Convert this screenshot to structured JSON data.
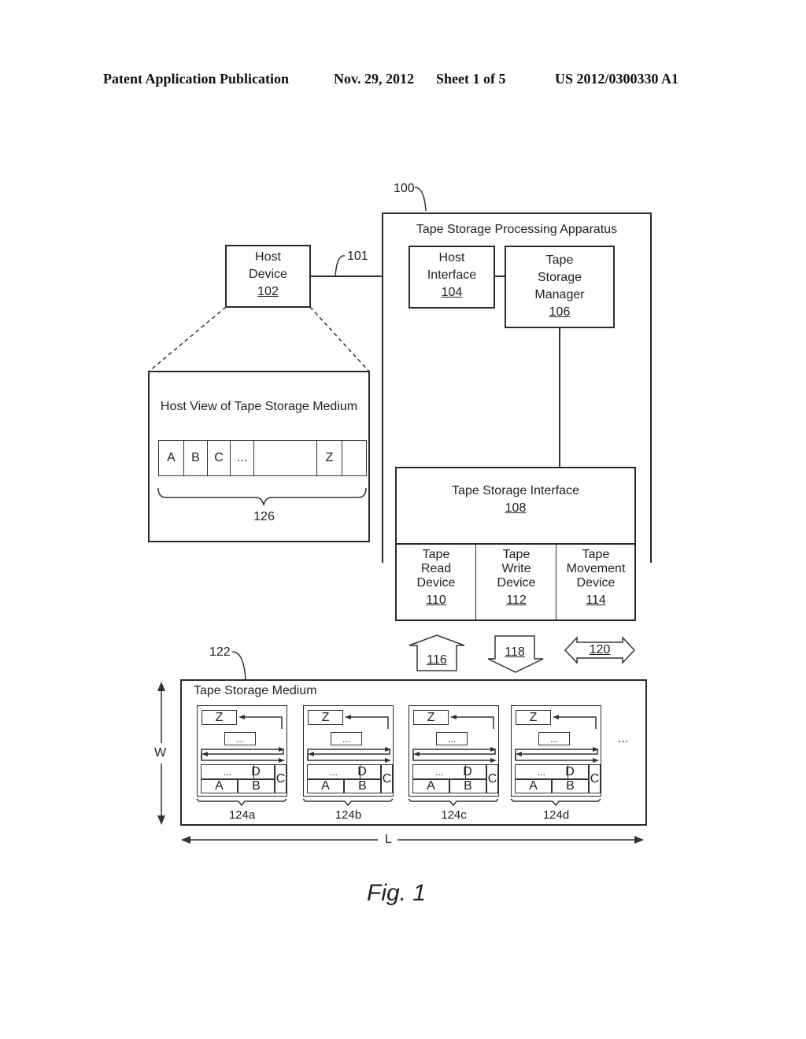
{
  "header": {
    "publication": "Patent Application Publication",
    "date": "Nov. 29, 2012",
    "sheet": "Sheet 1 of 5",
    "number": "US 2012/0300330 A1"
  },
  "refs": {
    "apparatus": "100",
    "link": "101",
    "medium": "122"
  },
  "apparatus": {
    "title": "Tape Storage Processing Apparatus"
  },
  "host_device": {
    "line1": "Host",
    "line2": "Device",
    "ref": "102"
  },
  "host_interface": {
    "line1": "Host",
    "line2": "Interface",
    "ref": "104"
  },
  "tape_storage_manager": {
    "line1": "Tape",
    "line2": "Storage",
    "line3": "Manager",
    "ref": "106"
  },
  "tape_storage_interface": {
    "title": "Tape Storage Interface",
    "ref": "108"
  },
  "devices": [
    {
      "line1": "Tape",
      "line2": "Read",
      "line3": "Device",
      "ref": "110"
    },
    {
      "line1": "Tape",
      "line2": "Write",
      "line3": "Device",
      "ref": "112"
    },
    {
      "line1": "Tape",
      "line2": "Movement",
      "line3": "Device",
      "ref": "114"
    }
  ],
  "arrows": {
    "read": "116",
    "write": "118",
    "move": "120"
  },
  "host_view": {
    "title": "Host View of Tape Storage Medium",
    "cells": [
      "A",
      "B",
      "C",
      "...",
      "",
      "Z",
      ""
    ],
    "ref": "126"
  },
  "medium": {
    "title": "Tape Storage Medium",
    "segments": [
      {
        "ref": "124a",
        "top": "Z",
        "mid": "...",
        "r1": [
          "...",
          "D"
        ],
        "r2": [
          "A",
          "B"
        ],
        "side": "C"
      },
      {
        "ref": "124b",
        "top": "Z",
        "mid": "...",
        "r1": [
          "...",
          "D"
        ],
        "r2": [
          "A",
          "B"
        ],
        "side": "C"
      },
      {
        "ref": "124c",
        "top": "Z",
        "mid": "...",
        "r1": [
          "...",
          "D"
        ],
        "r2": [
          "A",
          "B"
        ],
        "side": "C"
      },
      {
        "ref": "124d",
        "top": "Z",
        "mid": "...",
        "r1": [
          "...",
          "D"
        ],
        "r2": [
          "A",
          "B"
        ],
        "side": "C"
      }
    ],
    "more": "...",
    "width_label": "W",
    "length_label": "L"
  },
  "caption": "Fig. 1"
}
